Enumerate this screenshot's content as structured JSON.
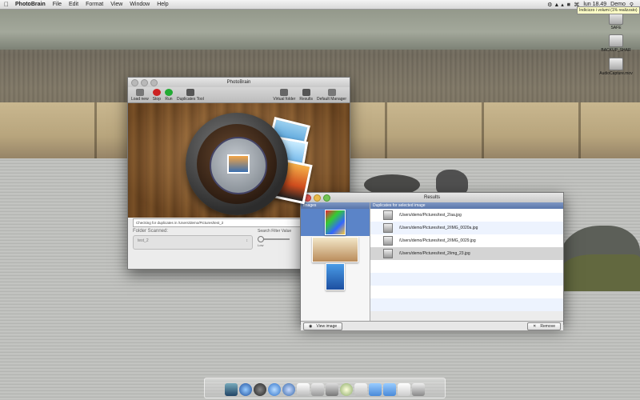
{
  "menubar": {
    "apple": "",
    "app_name": "PhotoBrain",
    "menus": [
      "File",
      "Edit",
      "Format",
      "View",
      "Window",
      "Help"
    ],
    "clock": "lun 18.49",
    "user": "Demo",
    "tooltip": "Indicizzo i volumi (1% realizzato)"
  },
  "desktop_icons": [
    {
      "label": "SAFE"
    },
    {
      "label": "BACKUP_SHAR"
    },
    {
      "label": "AudioCapture.mov"
    }
  ],
  "photobrain": {
    "title": "PhotoBrain",
    "toolbar": {
      "load_new": "Load new",
      "stop": "Stop",
      "run": "Run",
      "duplicates_tool": "Duplicates Tool",
      "virtual_folder": "Virtual folder",
      "results": "Results",
      "default_manager": "Default Manager"
    },
    "status": "Checking for duplicates in /Users/demo/Pictures/test_2",
    "folder_scanned_label": "Folder Scanned:",
    "folder_value": "test_2",
    "filter_label": "Search Filter Value",
    "filter_low": "Low",
    "filter_level": 0.0
  },
  "results": {
    "title": "Results",
    "col_images": "Images",
    "col_duplicates": "Duplicates for selected image",
    "duplicates": [
      "/Users/demo/Pictures/test_2/aa.jpg",
      "/Users/demo/Pictures/test_2/IMG_0020a.jpg",
      "/Users/demo/Pictures/test_2/IMG_0029.jpg",
      "/Users/demo/Pictures/test_2/img_23.jpg"
    ],
    "view_image": "View image",
    "remove": "Remove"
  }
}
